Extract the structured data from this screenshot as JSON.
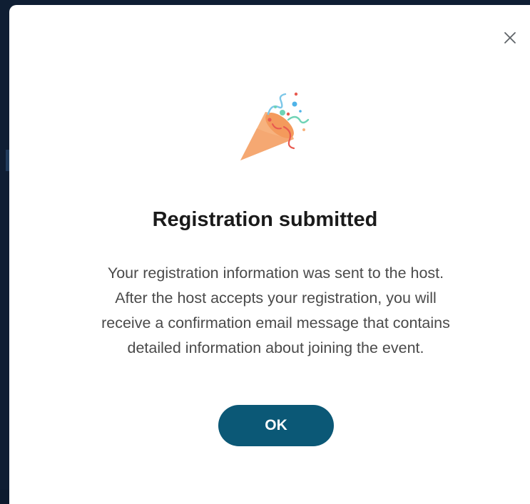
{
  "dialog": {
    "illustration_icon": "party-popper-icon",
    "close_icon": "close-icon",
    "title": "Registration submitted",
    "message_lines": [
      "Your registration information was sent to the host.",
      "After the host accepts your registration, you will",
      "receive a confirmation email message that contains",
      "detailed information about joining the event."
    ],
    "ok_label": "OK"
  },
  "colors": {
    "primary_button": "#0b5876",
    "title_text": "#1a1a1a",
    "body_text": "#4a4a4a",
    "backdrop": "#0f1e33"
  }
}
